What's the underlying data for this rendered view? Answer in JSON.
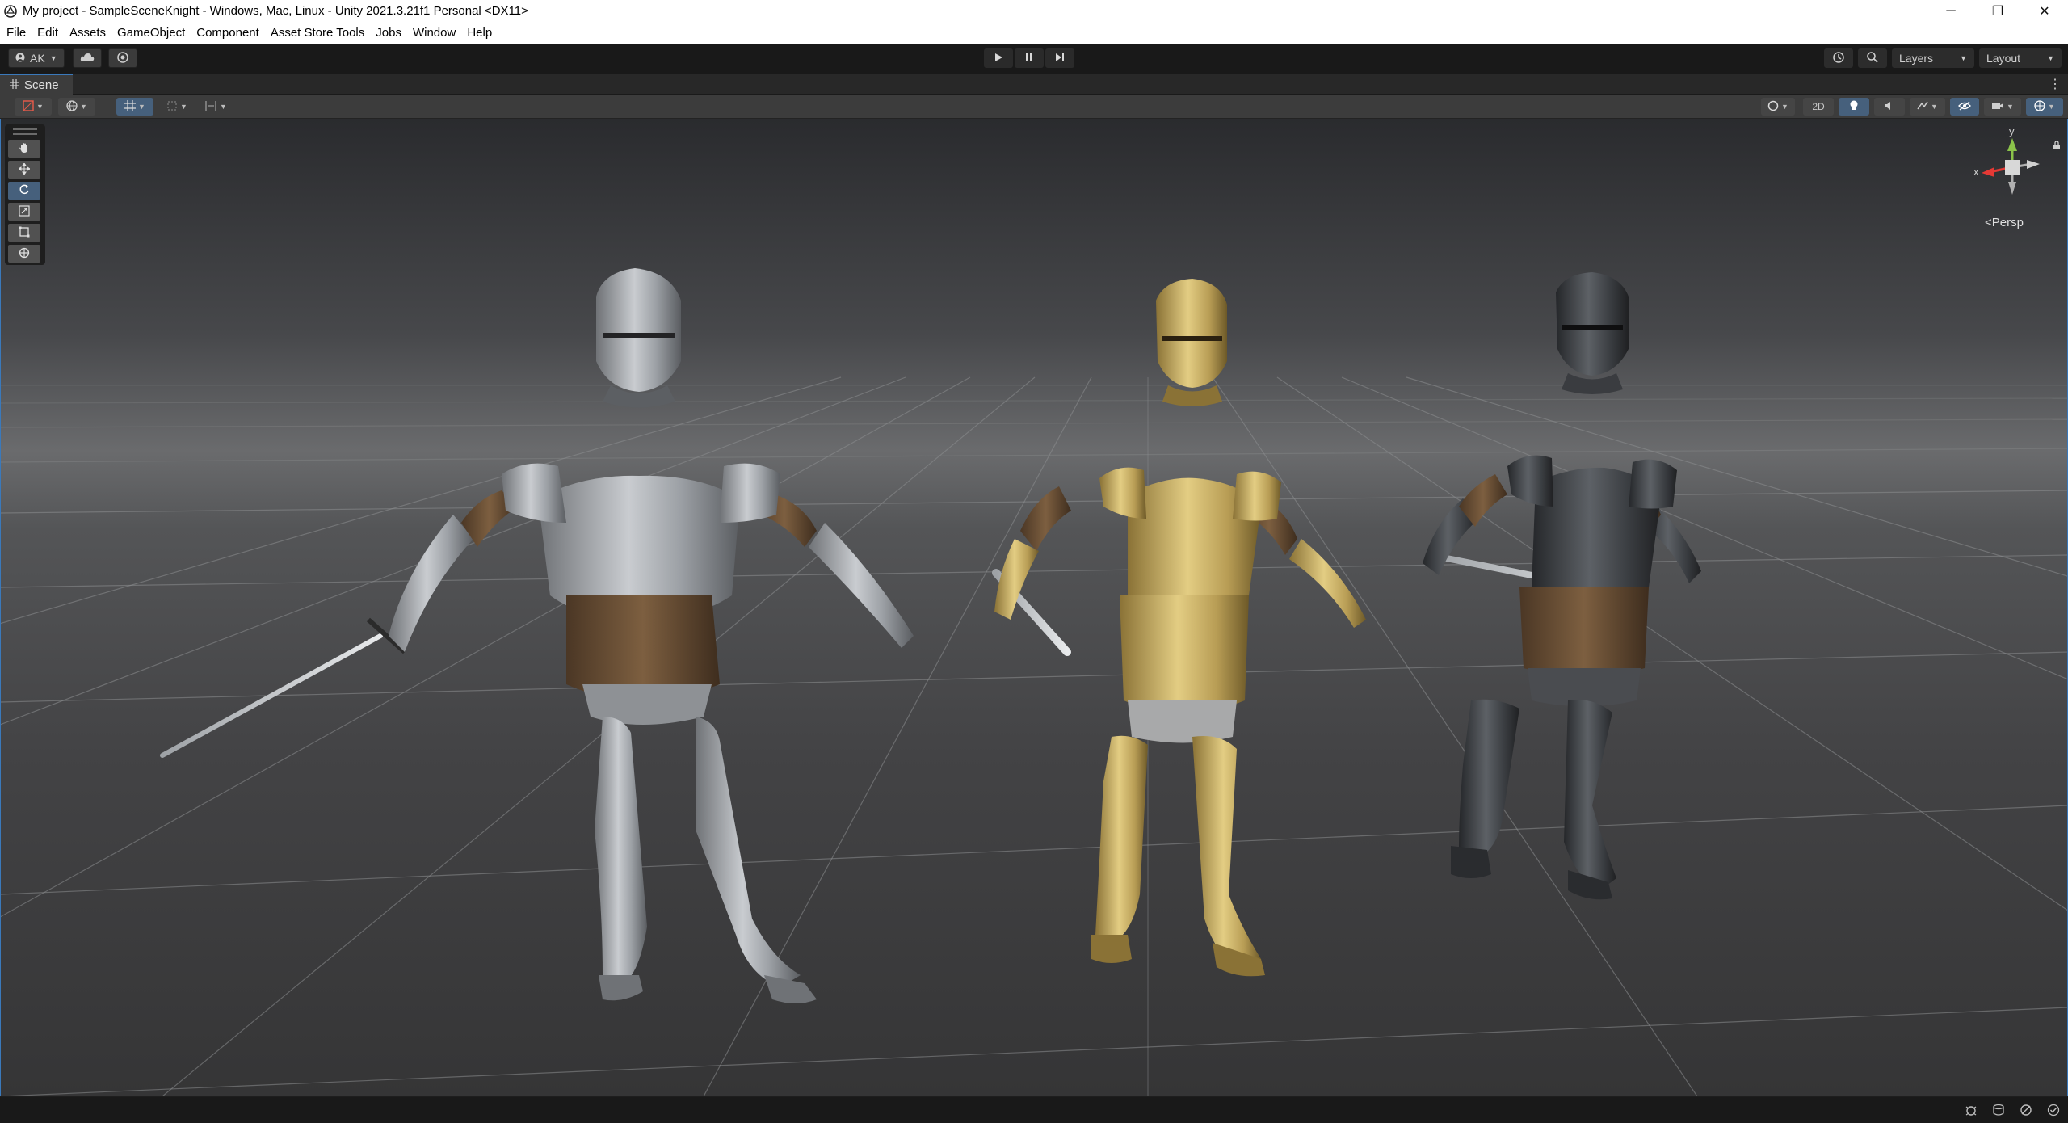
{
  "window": {
    "title": "My project - SampleSceneKnight - Windows, Mac, Linux - Unity 2021.3.21f1 Personal <DX11>",
    "minimize_glyph": "─",
    "restore_glyph": "❐",
    "close_glyph": "✕"
  },
  "menu": {
    "items": [
      "File",
      "Edit",
      "Assets",
      "GameObject",
      "Component",
      "Asset Store Tools",
      "Jobs",
      "Window",
      "Help"
    ]
  },
  "toolbar": {
    "account_label": "AK",
    "layers_label": "Layers",
    "layout_label": "Layout",
    "play_state": "stopped"
  },
  "scene_tab": {
    "label": "Scene"
  },
  "scene_toolbar": {
    "mode_2d_label": "2D"
  },
  "tools": {
    "items": [
      "hand-tool",
      "move-tool",
      "rotate-tool",
      "scale-tool",
      "rect-tool",
      "transform-tool"
    ],
    "active": "rotate-tool"
  },
  "gizmo": {
    "y_label": "y",
    "x_label": "x",
    "projection_label": "<Persp"
  },
  "viewport": {
    "objects": [
      "steel-knight",
      "gold-knight",
      "dark-knight"
    ],
    "colors": {
      "sky_top": "#2b2c2f",
      "horizon": "#6f7072",
      "ground": "#3b3b3c",
      "grid_line": "#8a8b8d",
      "selection_border": "#3a79bb"
    }
  },
  "status": {
    "icons": [
      "debug-icon",
      "cache-icon",
      "bug-icon",
      "check-icon"
    ]
  }
}
